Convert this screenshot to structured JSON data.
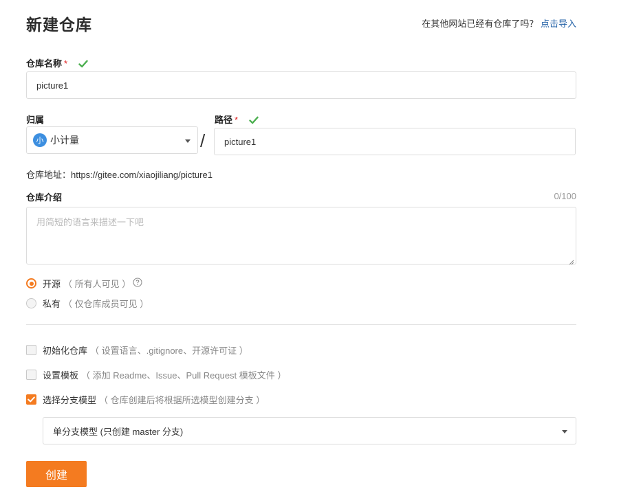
{
  "page": {
    "title": "新建仓库",
    "import_prompt": "在其他网站已经有仓库了吗？",
    "import_link": "点击导入"
  },
  "repo_name": {
    "label": "仓库名称",
    "required_mark": "*",
    "value": "picture1"
  },
  "owner": {
    "label": "归属",
    "avatar_text": "小",
    "value": "小计量"
  },
  "separator": "/",
  "path": {
    "label": "路径",
    "required_mark": "*",
    "value": "picture1"
  },
  "address": "仓库地址：https://gitee.com/xiaojiliang/picture1",
  "description": {
    "label": "仓库介绍",
    "counter": "0/100",
    "placeholder": "用简短的语言来描述一下吧"
  },
  "visibility": {
    "public": {
      "label": "开源",
      "hint": "（ 所有人可见 ）",
      "selected": true
    },
    "private": {
      "label": "私有",
      "hint": "（ 仅仓库成员可见 ）",
      "selected": false
    }
  },
  "options": {
    "init_repo": {
      "label": "初始化仓库",
      "hint": "（ 设置语言、.gitignore、开源许可证 ）",
      "checked": false
    },
    "templates": {
      "label": "设置模板",
      "hint": "（ 添加 Readme、Issue、Pull Request 模板文件 ）",
      "checked": false
    },
    "branch_model": {
      "label": "选择分支模型",
      "hint": "（ 仓库创建后将根据所选模型创建分支 ）",
      "checked": true
    }
  },
  "branch_select": {
    "value": "单分支模型 (只创建 master 分支)"
  },
  "create_button": "创建",
  "colors": {
    "accent": "#f47b20",
    "link": "#1f5fa6",
    "valid_check": "#4caf50",
    "required": "#e02020",
    "avatar": "#3d8fe0"
  }
}
